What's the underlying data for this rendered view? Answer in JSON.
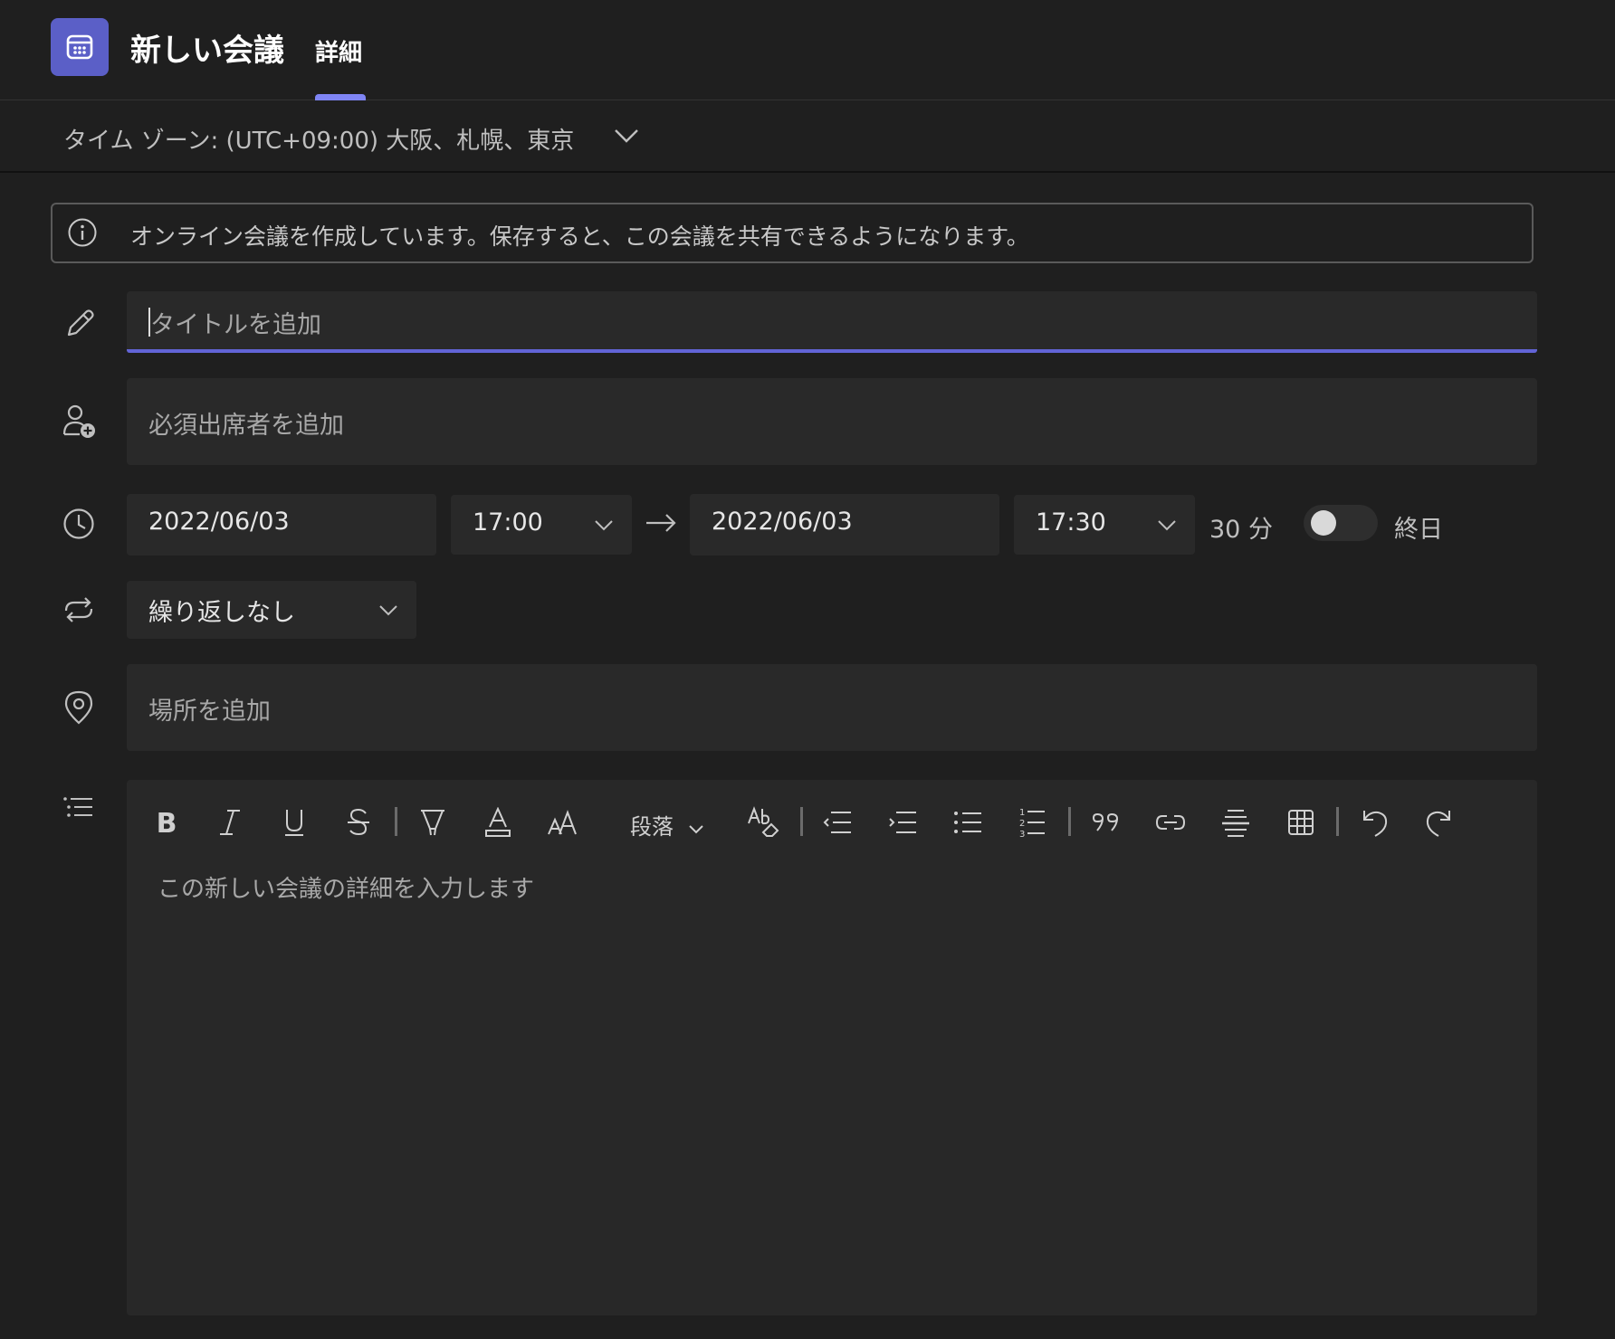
{
  "header": {
    "title": "新しい会議",
    "tab_label": "詳細",
    "app_icon": "calendar-icon"
  },
  "timezone": {
    "label": "タイム ゾーン: (UTC+09:00) 大阪、札幌、東京"
  },
  "info": {
    "message": "オンライン会議を作成しています。保存すると、この会議を共有できるようになります。"
  },
  "form": {
    "title_placeholder": "タイトルを追加",
    "attendees_placeholder": "必須出席者を追加",
    "start_date": "2022/06/03",
    "start_time": "17:00",
    "end_date": "2022/06/03",
    "end_time": "17:30",
    "duration": "30 分",
    "all_day_label": "終日",
    "all_day": false,
    "repeat": "繰り返しなし",
    "location_placeholder": "場所を追加"
  },
  "editor": {
    "paragraph_label": "段落",
    "placeholder": "この新しい会議の詳細を入力します"
  },
  "colors": {
    "accent": "#5b5fc7",
    "background": "#1f1f1f",
    "field": "#292929"
  }
}
